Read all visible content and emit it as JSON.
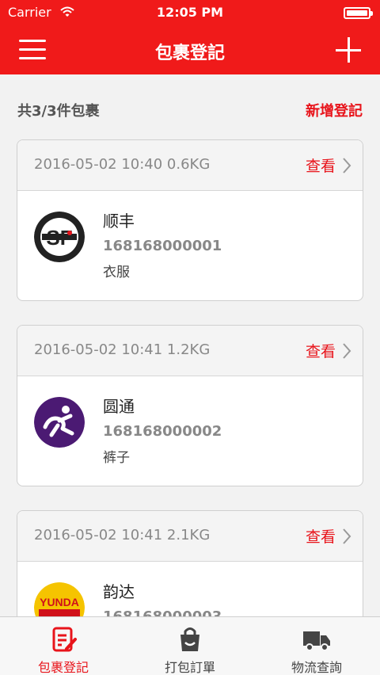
{
  "status": {
    "carrier": "Carrier",
    "time": "12:05 PM"
  },
  "nav": {
    "title": "包裹登記"
  },
  "summary": {
    "count_text": "共3/3件包裹",
    "new_label": "新增登記"
  },
  "packages": [
    {
      "meta": "2016-05-02 10:40 0.6KG",
      "view_label": "查看",
      "courier": "顺丰",
      "tracking": "168168000001",
      "item": "衣服",
      "logo_icon": "sf-express-logo",
      "logo_color": "#e8141b"
    },
    {
      "meta": "2016-05-02 10:41 1.2KG",
      "view_label": "查看",
      "courier": "圆通",
      "tracking": "168168000002",
      "item": "裤子",
      "logo_icon": "yto-express-logo",
      "logo_color": "#4b1a73"
    },
    {
      "meta": "2016-05-02 10:41 2.1KG",
      "view_label": "查看",
      "courier": "韵达",
      "tracking": "168168000003",
      "item": "",
      "logo_icon": "yunda-express-logo",
      "logo_color": "#f5c400"
    }
  ],
  "tabs": [
    {
      "label": "包裹登記",
      "icon": "package-register-icon",
      "active": true
    },
    {
      "label": "打包訂單",
      "icon": "bag-icon",
      "active": false
    },
    {
      "label": "物流查詢",
      "icon": "truck-icon",
      "active": false
    }
  ],
  "colors": {
    "brand_red": "#f01a1a",
    "accent_red": "#e8141b",
    "background": "#f2f2f2"
  }
}
